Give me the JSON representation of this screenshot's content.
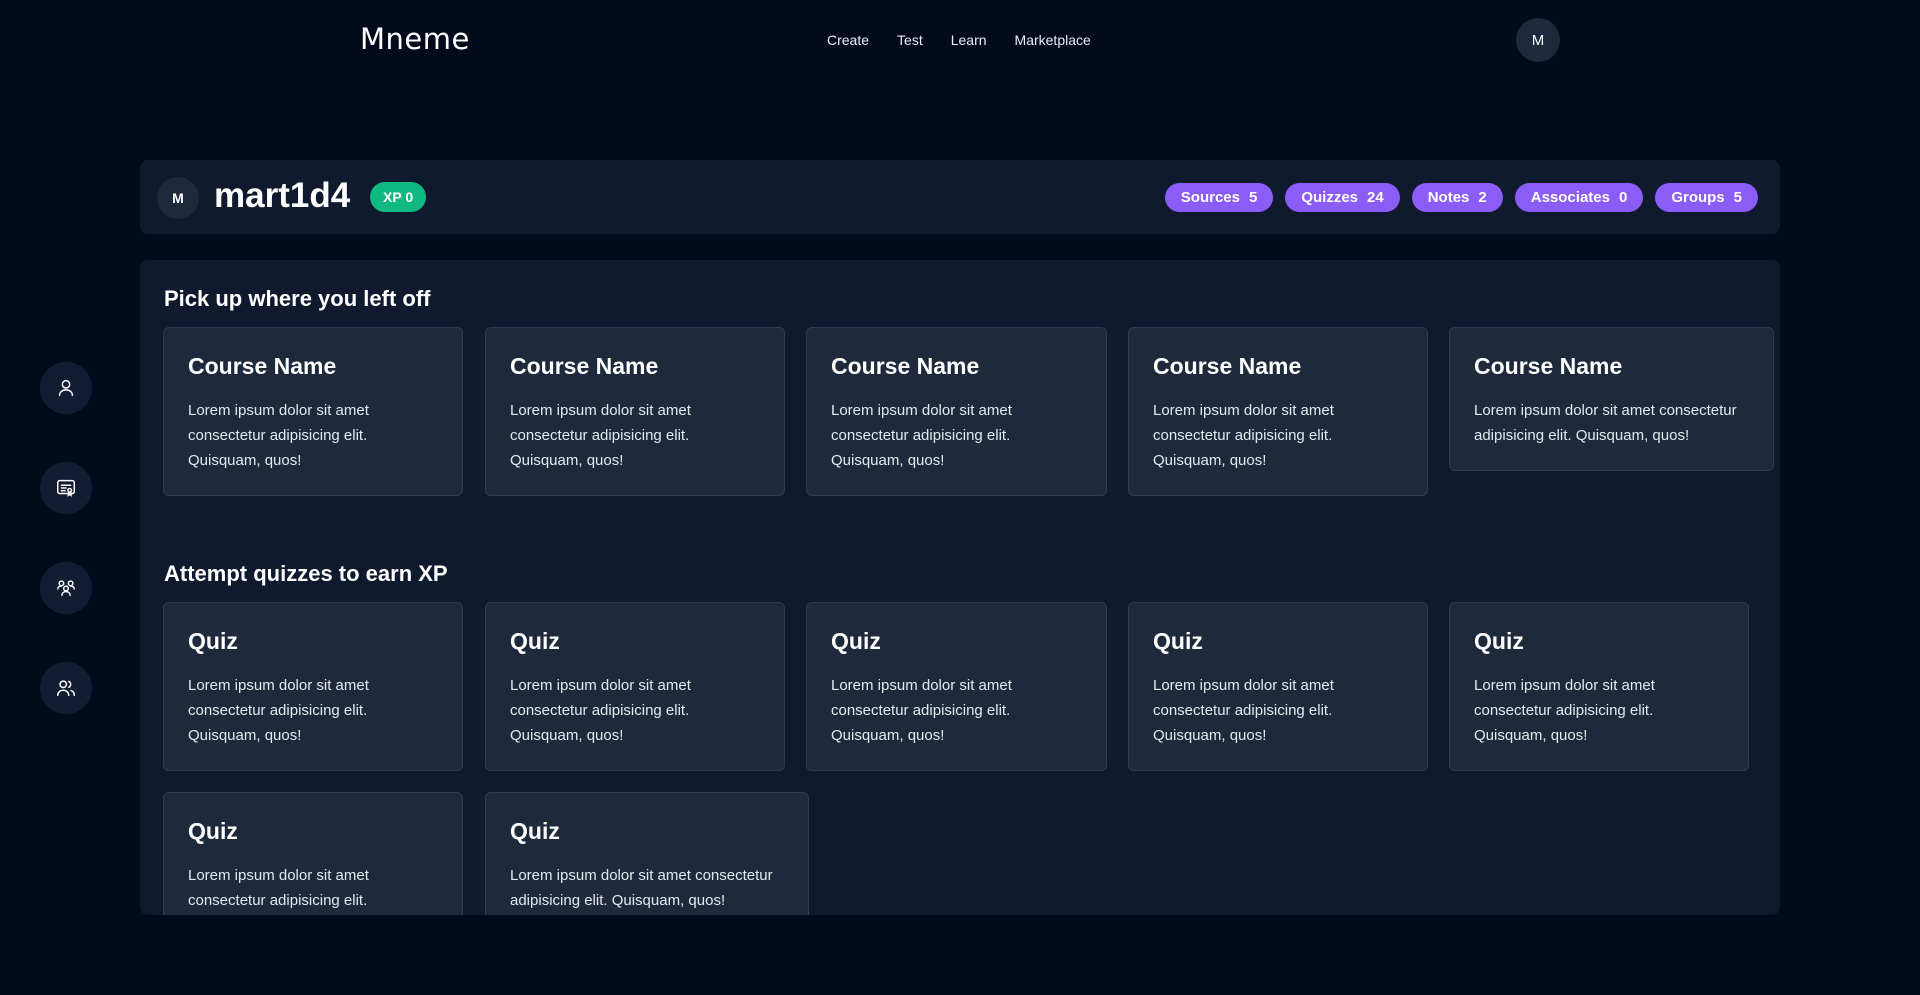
{
  "nav": {
    "brand": "Mneme",
    "links": [
      "Create",
      "Test",
      "Learn",
      "Marketplace"
    ],
    "avatar_initial": "M"
  },
  "sidebar": {
    "items": [
      {
        "icon": "user-icon"
      },
      {
        "icon": "certificate-icon"
      },
      {
        "icon": "group-icon"
      },
      {
        "icon": "users-icon"
      }
    ]
  },
  "profile": {
    "avatar_initial": "M",
    "username": "mart1d4",
    "xp_label": "XP 0",
    "stats": [
      {
        "label": "Sources",
        "count": "5"
      },
      {
        "label": "Quizzes",
        "count": "24"
      },
      {
        "label": "Notes",
        "count": "2"
      },
      {
        "label": "Associates",
        "count": "0"
      },
      {
        "label": "Groups",
        "count": "5"
      }
    ]
  },
  "courses": {
    "title": "Pick up where you left off",
    "items": [
      {
        "title": "Course Name",
        "text": "Lorem ipsum dolor sit amet consectetur adipisicing elit. Quisquam, quos!"
      },
      {
        "title": "Course Name",
        "text": "Lorem ipsum dolor sit amet consectetur adipisicing elit. Quisquam, quos!"
      },
      {
        "title": "Course Name",
        "text": "Lorem ipsum dolor sit amet consectetur adipisicing elit. Quisquam, quos!"
      },
      {
        "title": "Course Name",
        "text": "Lorem ipsum dolor sit amet consectetur adipisicing elit. Quisquam, quos!"
      },
      {
        "title": "Course Name",
        "text": "Lorem ipsum dolor sit amet consectetur adipisicing elit. Quisquam, quos!"
      }
    ]
  },
  "quizzes": {
    "title": "Attempt quizzes to earn XP",
    "items": [
      {
        "title": "Quiz",
        "text": "Lorem ipsum dolor sit amet consectetur adipisicing elit. Quisquam, quos!"
      },
      {
        "title": "Quiz",
        "text": "Lorem ipsum dolor sit amet consectetur adipisicing elit. Quisquam, quos!"
      },
      {
        "title": "Quiz",
        "text": "Lorem ipsum dolor sit amet consectetur adipisicing elit. Quisquam, quos!"
      },
      {
        "title": "Quiz",
        "text": "Lorem ipsum dolor sit amet consectetur adipisicing elit. Quisquam, quos!"
      },
      {
        "title": "Quiz",
        "text": "Lorem ipsum dolor sit amet consectetur adipisicing elit. Quisquam, quos!"
      },
      {
        "title": "Quiz",
        "text": "Lorem ipsum dolor sit amet consectetur adipisicing elit. Quisquam, quos!"
      },
      {
        "title": "Quiz",
        "text": "Lorem ipsum dolor sit amet consectetur adipisicing elit. Quisquam, quos!"
      }
    ]
  },
  "colors": {
    "background": "#030a1c",
    "panel": "#0f1a2e",
    "card": "#1e293b",
    "xp_badge": "#10b981",
    "stat_pill": "#8b5cf6"
  }
}
